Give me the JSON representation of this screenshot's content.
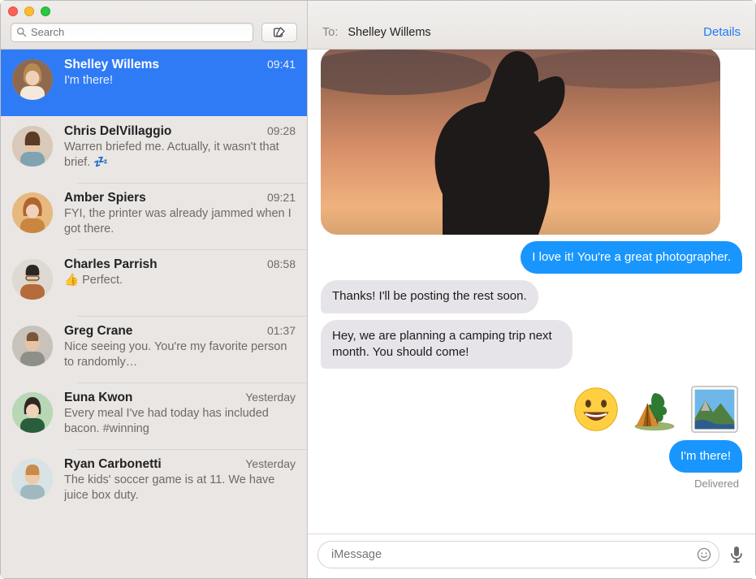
{
  "search": {
    "placeholder": "Search"
  },
  "toolbar": {
    "compose_title": "New Message"
  },
  "sidebar": {
    "conversations": [
      {
        "name": "Shelley Willems",
        "time": "09:41",
        "preview": "I'm there!",
        "selected": true
      },
      {
        "name": "Chris DelVillaggio",
        "time": "09:28",
        "preview": "Warren briefed me. Actually, it wasn't that brief. 💤"
      },
      {
        "name": "Amber Spiers",
        "time": "09:21",
        "preview": "FYI, the printer was already jammed when I got there."
      },
      {
        "name": "Charles Parrish",
        "time": "08:58",
        "preview": "👍 Perfect."
      },
      {
        "name": "Greg Crane",
        "time": "01:37",
        "preview": "Nice seeing you. You're my favorite person to randomly…"
      },
      {
        "name": "Euna Kwon",
        "time": "Yesterday",
        "preview": "Every meal I've had today has included bacon. #winning"
      },
      {
        "name": "Ryan Carbonetti",
        "time": "Yesterday",
        "preview": "The kids' soccer game is at 11. We have juice box duty."
      }
    ]
  },
  "header": {
    "to_label": "To:",
    "to_name": "Shelley Willems",
    "details_label": "Details"
  },
  "thread": {
    "msg_sent_1": "I love it! You're a great photographer.",
    "msg_recv_1": "Thanks! I'll be posting the rest soon.",
    "msg_recv_2": "Hey, we are planning a camping trip next month. You should come!",
    "msg_sent_2": "I'm there!",
    "status_1": "Delivered"
  },
  "composer": {
    "placeholder": "iMessage"
  }
}
